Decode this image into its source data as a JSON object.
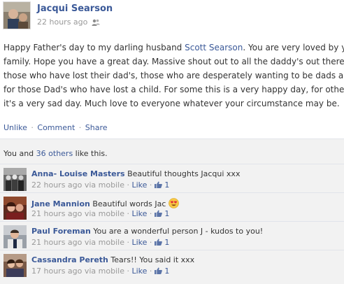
{
  "post": {
    "author": "Jacqui Searson",
    "timestamp": "22 hours ago",
    "audience_icon": "friends-icon",
    "text_lines": [
      [
        "Happy Father's day to my darling husband ",
        "Scott Searson",
        ". You are very loved by your"
      ],
      "family. Hope you have a great day. Massive shout out to all the daddy's out there,",
      "those who have lost their dad's, those who are desperately wanting to be dads and",
      "for those Dad's who have lost a child. For some this is a very happy day, for others",
      "it's a very sad day. Much love to everyone whatever your circumstance may be."
    ],
    "actions": {
      "unlike": "Unlike",
      "comment": "Comment",
      "share": "Share",
      "separator": "·"
    }
  },
  "likes": {
    "prefix": "You and ",
    "others_link": "36 others",
    "suffix": " like this."
  },
  "comments": [
    {
      "name": "Anna- Louise Masters",
      "text": "Beautiful thoughts Jacqui xxx",
      "time": "22 hours ago via mobile",
      "like_label": "Like",
      "like_count": "1",
      "emoji": ""
    },
    {
      "name": "Jane Mannion",
      "text": "Beautiful words Jac",
      "time": "21 hours ago via mobile",
      "like_label": "Like",
      "like_count": "1",
      "emoji": "heart-eyes-emoji"
    },
    {
      "name": "Paul Foreman",
      "text": "You are a wonderful person J - kudos to you!",
      "time": "21 hours ago via mobile",
      "like_label": "Like",
      "like_count": "1",
      "emoji": ""
    },
    {
      "name": "Cassandra Pereth",
      "text": "Tears!! You said it xxx",
      "time": "17 hours ago via mobile",
      "like_label": "Like",
      "like_count": "1",
      "emoji": ""
    }
  ],
  "colors": {
    "link": "#3b5998",
    "meta": "#999999",
    "comment_bg": "#f2f2f2"
  }
}
